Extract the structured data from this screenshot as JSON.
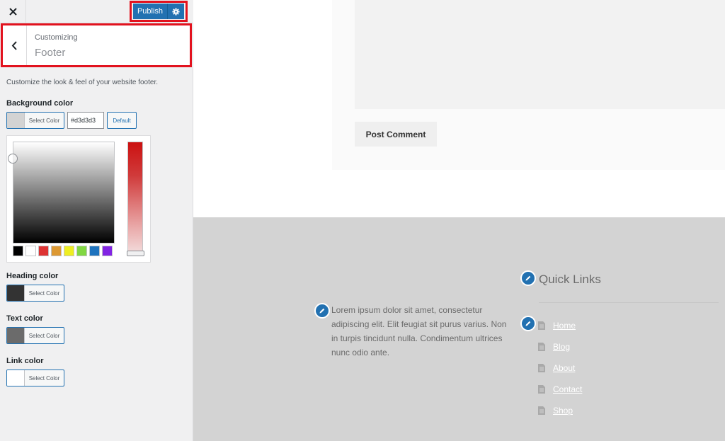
{
  "topbar": {
    "publish_label": "Publish",
    "publish_color": "#2271b1"
  },
  "section": {
    "subtitle": "Customizing",
    "title": "Footer"
  },
  "description": "Customize the look & feel of your website footer.",
  "controls": {
    "background": {
      "label": "Background color",
      "button_label": "Select Color",
      "hex_value": "#d3d3d3",
      "default_label": "Default",
      "swatch": "#d3d3d3"
    },
    "heading": {
      "label": "Heading color",
      "button_label": "Select Color",
      "swatch": "#333333"
    },
    "text": {
      "label": "Text color",
      "button_label": "Select Color",
      "swatch": "#6b6b6b"
    },
    "link": {
      "label": "Link color",
      "button_label": "Select Color",
      "swatch": "#ffffff"
    }
  },
  "picker": {
    "palette": [
      "#000000",
      "#ffffff",
      "#dd3333",
      "#dd9933",
      "#eeee22",
      "#81d742",
      "#1e73be",
      "#8224e3"
    ]
  },
  "preview": {
    "post_comment_label": "Post Comment",
    "footer": {
      "text": "Lorem ipsum dolor sit amet, consectetur adipiscing elit. Elit feugiat sit purus varius. Non in turpis tincidunt nulla. Condimentum ultrices nunc odio ante.",
      "quick_links_title": "Quick Links",
      "links": [
        {
          "label": "Home"
        },
        {
          "label": "Blog"
        },
        {
          "label": "About"
        },
        {
          "label": "Contact"
        },
        {
          "label": "Shop"
        }
      ]
    }
  },
  "icons": {
    "close": "close-icon",
    "gear": "gear-icon",
    "back": "chevron-left-icon",
    "edit": "pencil-icon",
    "page": "page-icon"
  }
}
